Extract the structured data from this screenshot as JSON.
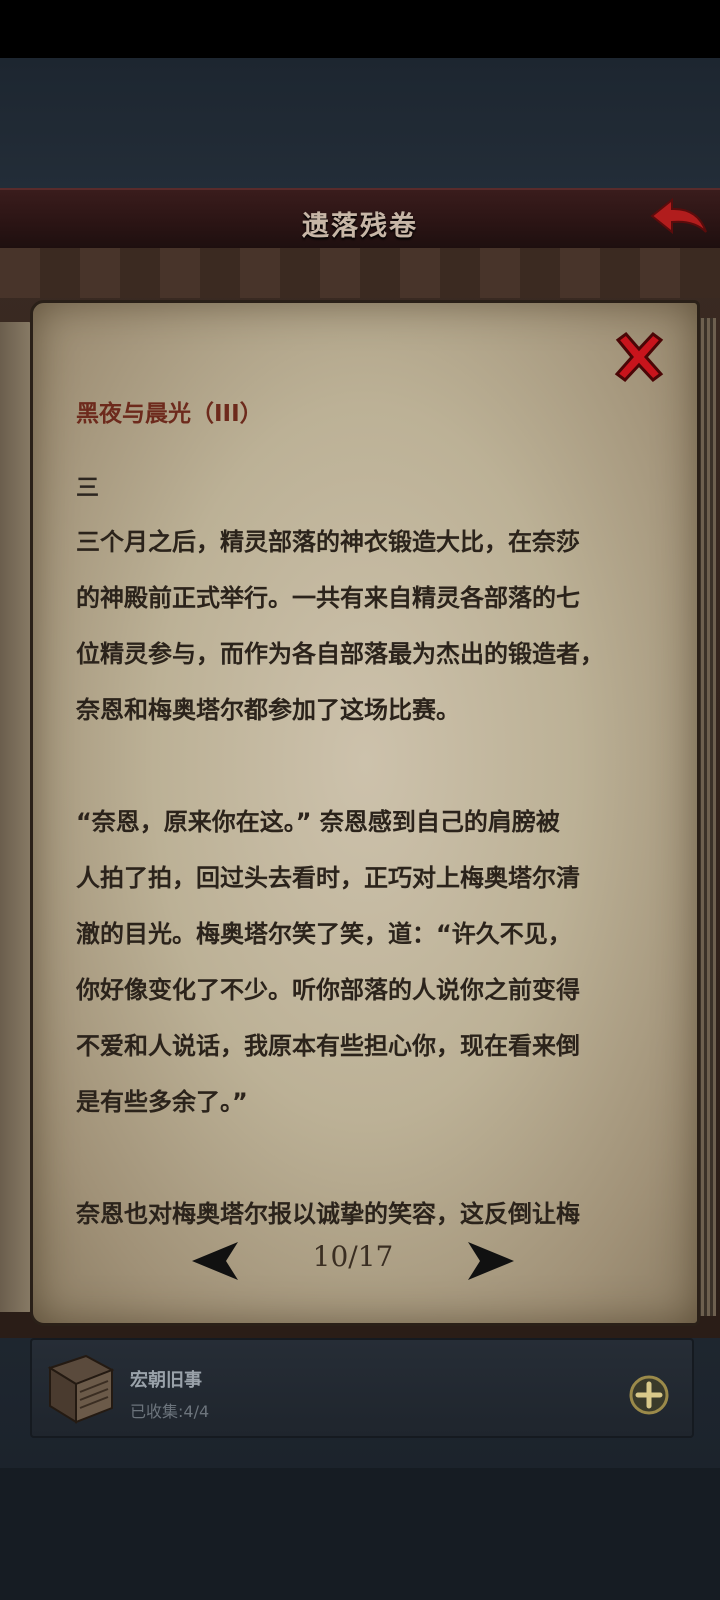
{
  "header": {
    "title": "遗落残卷"
  },
  "book": {
    "chapter_title": "黑夜与晨光（III）",
    "section_number": "三",
    "paragraphs": [
      "三个月之后，精灵部落的神衣锻造大比，在奈莎\n的神殿前正式举行。一共有来自精灵各部落的七\n位精灵参与，而作为各自部落最为杰出的锻造者，\n奈恩和梅奥塔尔都参加了这场比赛。",
      "“奈恩，原来你在这。” 奈恩感到自己的肩膀被\n人拍了拍，回过头去看时，正巧对上梅奥塔尔清\n澈的目光。梅奥塔尔笑了笑，道：“许久不见，\n你好像变化了不少。听你部落的人说你之前变得\n不爱和人说话，我原本有些担心你，现在看来倒\n是有些多余了。”",
      "奈恩也对梅奥塔尔报以诚挚的笑容，这反倒让梅"
    ],
    "page_indicator": "10/17"
  },
  "collection": {
    "name": "宏朝旧事",
    "progress": "已收集:4/4"
  },
  "icons": {
    "back": "back-arrow-icon",
    "close": "close-x-icon",
    "prev": "prev-page-arrow-icon",
    "next": "next-page-arrow-icon",
    "book": "book-icon",
    "plus": "plus-circle-icon"
  },
  "colors": {
    "title_text": "#c7b6a6",
    "chapter_title": "#6d2a1c",
    "body_text": "#2b231b",
    "close_red": "#c8141c",
    "back_red": "#b11d1d"
  }
}
